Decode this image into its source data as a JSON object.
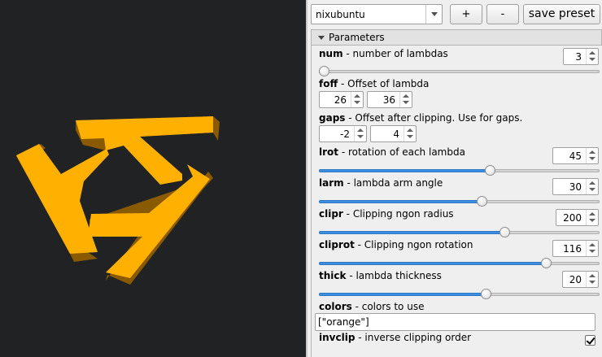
{
  "toolbar": {
    "preset": "nixubuntu",
    "add_label": "+",
    "remove_label": "-",
    "save_label": "save preset"
  },
  "group": {
    "title": "Parameters",
    "expanded": true
  },
  "params": {
    "num": {
      "name": "num",
      "desc": " - number of lambdas",
      "value": "3"
    },
    "foff": {
      "name": "foff",
      "desc": " - Offset of lambda",
      "values": [
        "26",
        "36"
      ]
    },
    "gaps": {
      "name": "gaps",
      "desc": " - Offset after clipping. Use for gaps.",
      "values": [
        "-2",
        "4"
      ]
    },
    "lrot": {
      "name": "lrot",
      "desc": " - rotation of each lambda",
      "value": "45"
    },
    "larm": {
      "name": "larm",
      "desc": " - lambda arm angle",
      "value": "30"
    },
    "clipr": {
      "name": "clipr",
      "desc": " - Clipping ngon radius",
      "value": "200"
    },
    "cliprot": {
      "name": "cliprot",
      "desc": " - Clipping ngon rotation",
      "value": "116"
    },
    "thick": {
      "name": "thick",
      "desc": " - lambda thickness",
      "value": "20"
    },
    "colors": {
      "name": "colors",
      "desc": " - colors to use",
      "value": "[\"orange\"]"
    },
    "invclip": {
      "name": "invclip",
      "desc": " - inverse clipping order",
      "checked": true
    }
  },
  "slider_levels": {
    "num": 0.0,
    "lrot": 0.61,
    "larm": 0.58,
    "clipr": 0.66,
    "cliprot": 0.81,
    "thick": 0.595
  },
  "colors": {
    "shape_face": "#ffb000",
    "shape_side": "#8a5a00",
    "viewport_bg": "#212224",
    "accent": "#3d8ee0"
  }
}
